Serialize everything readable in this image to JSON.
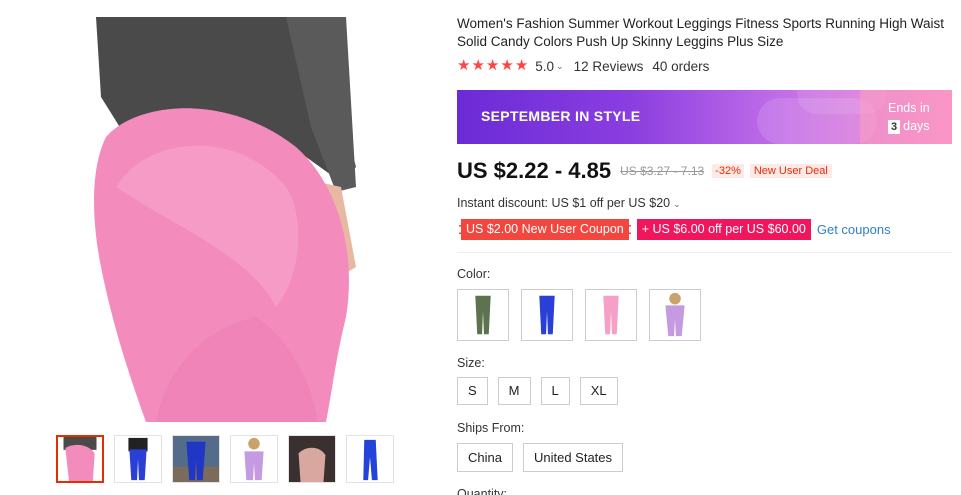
{
  "product": {
    "title": "Women's Fashion Summer Workout Leggings Fitness Sports Running High Waist Solid Candy Colors Push Up Skinny Leggins Plus Size",
    "rating": "5.0",
    "reviews": "12 Reviews",
    "orders": "40 orders"
  },
  "banner": {
    "title": "SEPTEMBER IN STYLE",
    "ends_label": "Ends in",
    "ends_days": "3",
    "ends_unit": "days"
  },
  "price": {
    "current": "US $2.22 - 4.85",
    "original": "US $3.27 - 7.13",
    "discount": "-32%",
    "deal": "New User Deal"
  },
  "instant_discount": "Instant discount: US $1 off per US $20",
  "coupons": {
    "coupon1": "US $2.00 New User Coupon",
    "coupon2": "+ US $6.00 off per US $60.00",
    "get_label": "Get coupons"
  },
  "options": {
    "color_label": "Color:",
    "colors": [
      "olive-green",
      "royal-blue",
      "pink",
      "lavender-purple"
    ],
    "size_label": "Size:",
    "sizes": [
      "S",
      "M",
      "L",
      "XL"
    ],
    "ships_label": "Ships From:",
    "ships": [
      "China",
      "United States"
    ],
    "quantity_label": "Quantity:"
  },
  "colors": {
    "accent_red": "#e62e04",
    "pink_leggings": "#f48fc0",
    "banner_purple": "#7b3be0",
    "link_blue": "#2f80c8"
  }
}
